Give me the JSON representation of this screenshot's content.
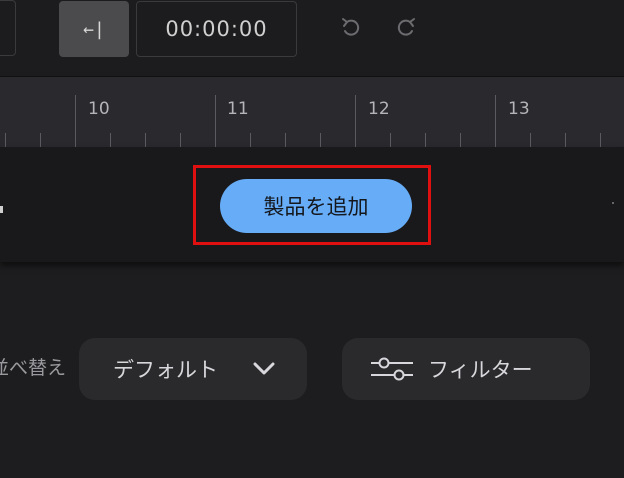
{
  "toolbar": {
    "collapse_glyph": "←|",
    "timecode": "00:00:00",
    "undo_icon": "undo-icon",
    "redo_icon": "redo-icon"
  },
  "ruler": {
    "labels": [
      "10",
      "11",
      "12",
      "13"
    ]
  },
  "product_panel": {
    "add_product_label": "製品を追加",
    "highlight_color": "#e01010",
    "button_color": "#66acf7"
  },
  "controls": {
    "sort_label": "並べ替え",
    "sort_value": "デフォルト",
    "filter_label": "フィルター"
  }
}
